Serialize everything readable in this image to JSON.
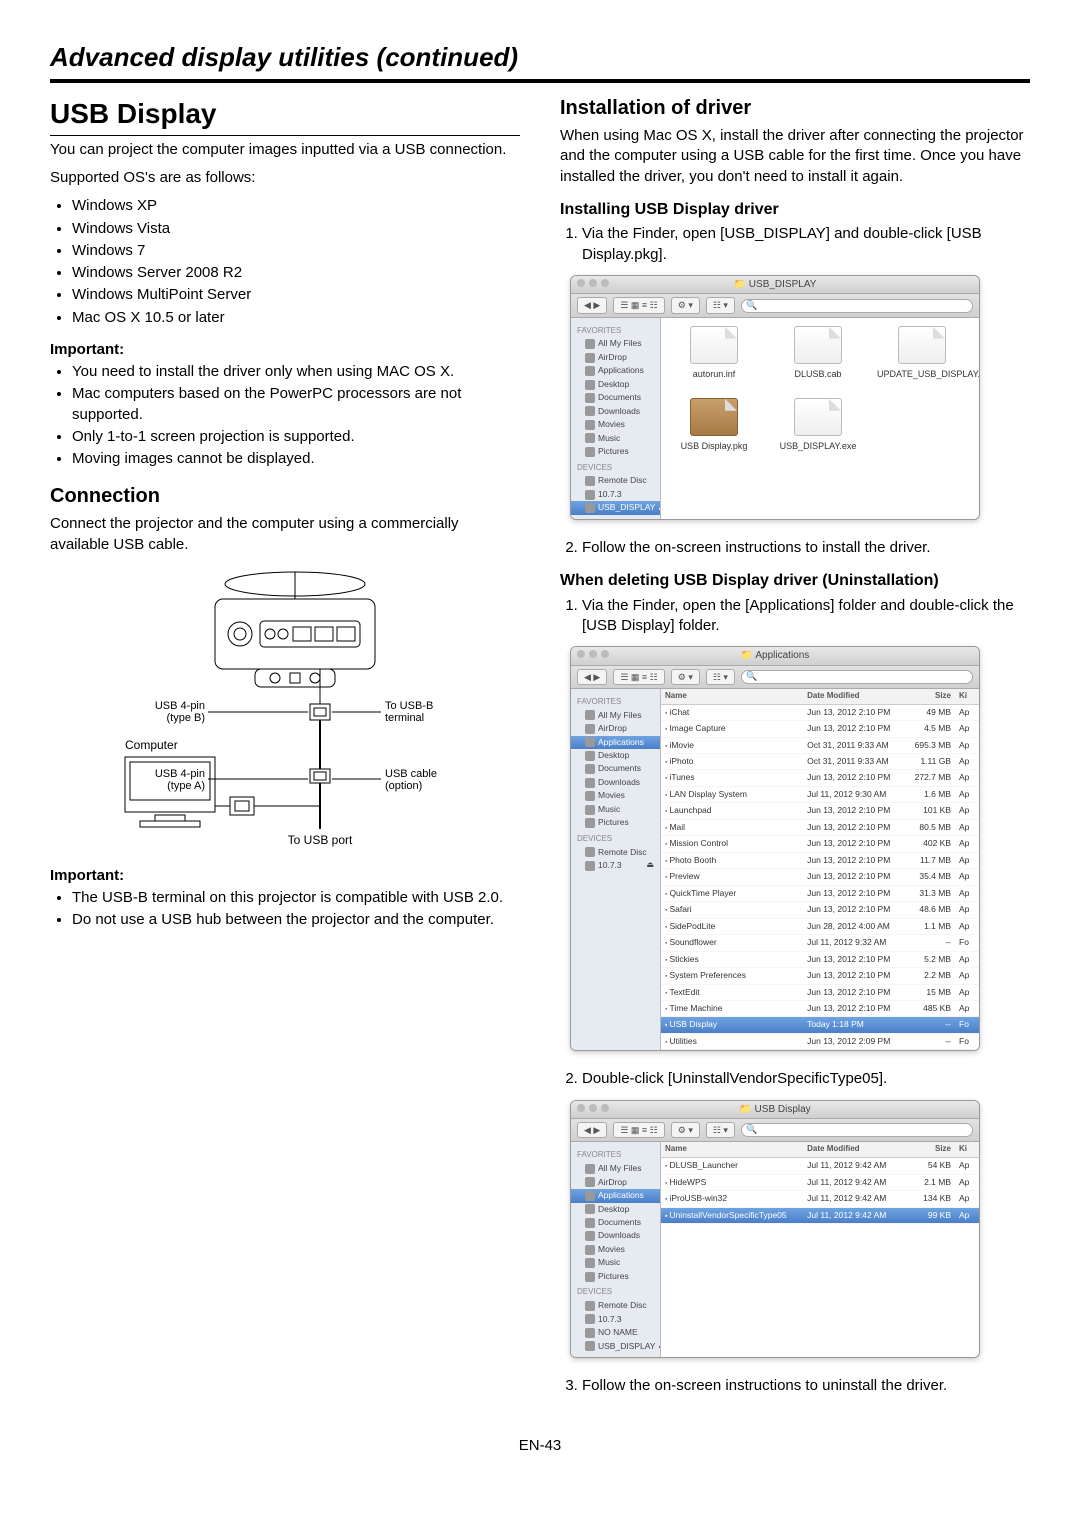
{
  "page_title": "Advanced display utilities (continued)",
  "page_number": "EN-43",
  "left": {
    "h1": "USB Display",
    "intro": "You can project the computer images inputted via a USB connection.",
    "supported_label": "Supported OS's are as follows:",
    "os_list": [
      "Windows XP",
      "Windows Vista",
      "Windows 7",
      "Windows Server 2008 R2",
      "Windows MultiPoint Server",
      "Mac OS X 10.5 or later"
    ],
    "important_label": "Important:",
    "important_items": [
      "You need to install the driver only when using MAC OS X.",
      "Mac computers based on the PowerPC processors are not supported.",
      "Only 1-to-1 screen projection is supported.",
      "Moving images cannot be displayed."
    ],
    "h2_conn": "Connection",
    "conn_text": "Connect the projector and the computer using a commercially available USB cable.",
    "diagram": {
      "usb4pin_b": "USB 4-pin\n(type B)",
      "to_usbb": "To USB-B\nterminal",
      "computer": "Computer",
      "usb4pin_a": "USB 4-pin\n(type A)",
      "usb_cable": "USB cable\n(option)",
      "to_usb_port": "To USB port"
    },
    "important2_label": "Important:",
    "important2_items": [
      "The USB-B terminal on this projector is compatible with USB 2.0.",
      "Do not use a USB hub between the projector and the computer."
    ]
  },
  "right": {
    "h2_install": "Installation of driver",
    "install_text": "When using Mac OS X, install the driver after connecting the projector and the computer using a USB cable for the first time. Once you have installed the driver, you don't need to install it again.",
    "h3_installing": "Installing USB Display driver",
    "step1": "Via the Finder, open [USB_DISPLAY] and double-click [USB Display.pkg].",
    "step2": "Follow the on-screen instructions to install the driver.",
    "h3_uninstall": "When deleting USB Display driver (Uninstallation)",
    "un_step1": "Via the Finder, open the [Applications] folder and double-click the [USB Display] folder.",
    "un_step2": "Double-click [UninstallVendorSpecificType05].",
    "un_step3": "Follow the on-screen instructions to uninstall the driver.",
    "finder1": {
      "title": "USB_DISPLAY",
      "sidebar_fav": "FAVORITES",
      "sidebar_dev": "DEVICES",
      "fav_items": [
        "All My Files",
        "AirDrop",
        "Applications",
        "Desktop",
        "Documents",
        "Downloads",
        "Movies",
        "Music",
        "Pictures"
      ],
      "dev_items": [
        "Remote Disc",
        "10.7.3",
        "USB_DISPLAY"
      ],
      "icons": [
        {
          "name": "autorun.inf",
          "pkg": false
        },
        {
          "name": "DLUSB.cab",
          "pkg": false
        },
        {
          "name": "UPDATE_USB_DISPLAY.cmd",
          "pkg": false
        },
        {
          "name": "USB Display.pkg",
          "pkg": true
        },
        {
          "name": "USB_DISPLAY.exe",
          "pkg": false
        }
      ]
    },
    "finder2": {
      "title": "Applications",
      "headers": {
        "name": "Name",
        "date": "Date Modified",
        "size": "Size",
        "kind": "Ki"
      },
      "rows": [
        {
          "name": "iChat",
          "date": "Jun 13, 2012 2:10 PM",
          "size": "49 MB",
          "kind": "Ap"
        },
        {
          "name": "Image Capture",
          "date": "Jun 13, 2012 2:10 PM",
          "size": "4.5 MB",
          "kind": "Ap"
        },
        {
          "name": "iMovie",
          "date": "Oct 31, 2011 9:33 AM",
          "size": "695.3 MB",
          "kind": "Ap"
        },
        {
          "name": "iPhoto",
          "date": "Oct 31, 2011 9:33 AM",
          "size": "1.11 GB",
          "kind": "Ap"
        },
        {
          "name": "iTunes",
          "date": "Jun 13, 2012 2:10 PM",
          "size": "272.7 MB",
          "kind": "Ap"
        },
        {
          "name": "LAN Display System",
          "date": "Jul 11, 2012 9:30 AM",
          "size": "1.6 MB",
          "kind": "Ap"
        },
        {
          "name": "Launchpad",
          "date": "Jun 13, 2012 2:10 PM",
          "size": "101 KB",
          "kind": "Ap"
        },
        {
          "name": "Mail",
          "date": "Jun 13, 2012 2:10 PM",
          "size": "80.5 MB",
          "kind": "Ap"
        },
        {
          "name": "Mission Control",
          "date": "Jun 13, 2012 2:10 PM",
          "size": "402 KB",
          "kind": "Ap"
        },
        {
          "name": "Photo Booth",
          "date": "Jun 13, 2012 2:10 PM",
          "size": "11.7 MB",
          "kind": "Ap"
        },
        {
          "name": "Preview",
          "date": "Jun 13, 2012 2:10 PM",
          "size": "35.4 MB",
          "kind": "Ap"
        },
        {
          "name": "QuickTime Player",
          "date": "Jun 13, 2012 2:10 PM",
          "size": "31.3 MB",
          "kind": "Ap"
        },
        {
          "name": "Safari",
          "date": "Jun 13, 2012 2:10 PM",
          "size": "48.6 MB",
          "kind": "Ap"
        },
        {
          "name": "SidePodLite",
          "date": "Jun 28, 2012 4:00 AM",
          "size": "1.1 MB",
          "kind": "Ap"
        },
        {
          "name": "Soundflower",
          "date": "Jul 11, 2012 9:32 AM",
          "size": "--",
          "kind": "Fo"
        },
        {
          "name": "Stickies",
          "date": "Jun 13, 2012 2:10 PM",
          "size": "5.2 MB",
          "kind": "Ap"
        },
        {
          "name": "System Preferences",
          "date": "Jun 13, 2012 2:10 PM",
          "size": "2.2 MB",
          "kind": "Ap"
        },
        {
          "name": "TextEdit",
          "date": "Jun 13, 2012 2:10 PM",
          "size": "15 MB",
          "kind": "Ap"
        },
        {
          "name": "Time Machine",
          "date": "Jun 13, 2012 2:10 PM",
          "size": "485 KB",
          "kind": "Ap"
        },
        {
          "name": "USB Display",
          "date": "Today 1:18 PM",
          "size": "--",
          "kind": "Fo",
          "sel": true
        },
        {
          "name": "Utilities",
          "date": "Jun 13, 2012 2:09 PM",
          "size": "--",
          "kind": "Fo"
        }
      ]
    },
    "finder3": {
      "title": "USB Display",
      "dev_items": [
        "Remote Disc",
        "10.7.3",
        "NO NAME",
        "USB_DISPLAY"
      ],
      "rows": [
        {
          "name": "DLUSB_Launcher",
          "date": "Jul 11, 2012 9:42 AM",
          "size": "54 KB",
          "kind": "Ap"
        },
        {
          "name": "HideWPS",
          "date": "Jul 11, 2012 9:42 AM",
          "size": "2.1 MB",
          "kind": "Ap"
        },
        {
          "name": "iProUSB-win32",
          "date": "Jul 11, 2012 9:42 AM",
          "size": "134 KB",
          "kind": "Ap"
        },
        {
          "name": "UninstallVendorSpecificType05",
          "date": "Jul 11, 2012 9:42 AM",
          "size": "99 KB",
          "kind": "Ap",
          "sel": true
        }
      ]
    }
  }
}
